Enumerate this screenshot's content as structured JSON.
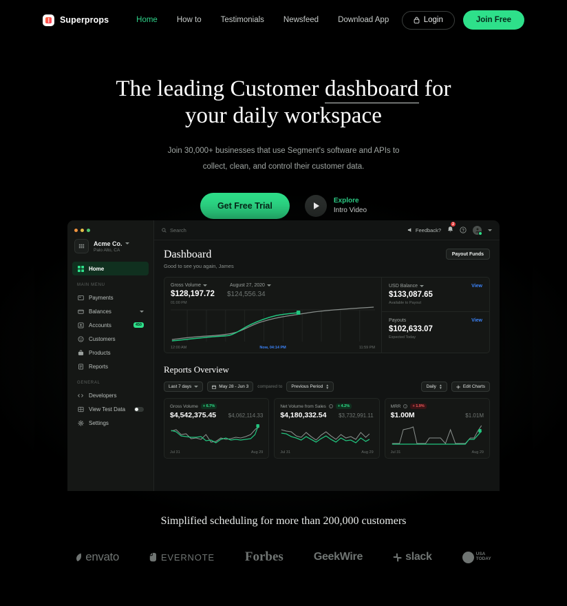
{
  "nav": {
    "brand": "Superprops",
    "links": [
      {
        "label": "Home",
        "active": true
      },
      {
        "label": "How to",
        "active": false
      },
      {
        "label": "Testimonials",
        "active": false
      },
      {
        "label": "Newsfeed",
        "active": false
      },
      {
        "label": "Download App",
        "active": false
      }
    ],
    "login_label": "Login",
    "join_label": "Join Free"
  },
  "hero": {
    "heading_part1": "The leading Customer ",
    "heading_underlined": "dashboard",
    "heading_part2": " for",
    "heading_line2": "your daily workspace",
    "sub_line1": "Join 30,000+ businesses that use Segment's software and APIs to",
    "sub_line2": "collect, clean, and control their customer data.",
    "cta_label": "Get Free Trial",
    "video_line1": "Explore",
    "video_line2": "Intro Video",
    "accent_color": "#2ee08a"
  },
  "dashboard": {
    "org_name": "Acme Co.",
    "org_location": "Palo Alto, CA",
    "search_placeholder": "Search",
    "feedback_label": "Feedback?",
    "notification_count": "2",
    "sidebar": [
      {
        "label": "Home",
        "icon": "grid-icon",
        "selected": true
      },
      {
        "group": "MAIN MENU"
      },
      {
        "label": "Payments",
        "icon": "card-icon"
      },
      {
        "label": "Balances",
        "icon": "wallet-icon",
        "caret": true
      },
      {
        "label": "Accounts",
        "icon": "person-icon",
        "badge": "450"
      },
      {
        "label": "Customers",
        "icon": "smiley-icon"
      },
      {
        "label": "Products",
        "icon": "bag-icon"
      },
      {
        "label": "Reports",
        "icon": "document-icon"
      },
      {
        "group": "GENERAL"
      },
      {
        "label": "Developers",
        "icon": "code-icon"
      },
      {
        "label": "View Test Data",
        "icon": "chart-icon",
        "toggle": true
      },
      {
        "label": "Settings",
        "icon": "gear-icon"
      }
    ],
    "page_title": "Dashboard",
    "page_subtitle": "Good to see you again, James",
    "payout_button": "Payout Funds",
    "gross_volume": {
      "label": "Gross Volume",
      "date_label": "August 27, 2020",
      "value": "$128,197.72",
      "compare_value": "$124,556.34",
      "time_label": "01:00 PM",
      "axis_left": "12:00 AM",
      "axis_now": "Now, 04:14 PM",
      "axis_right": "11:59 PM"
    },
    "usd_balance": {
      "label": "USD Balance",
      "view": "View",
      "value": "$133,087.65",
      "sub": "Available to Payout"
    },
    "payouts": {
      "label": "Payouts",
      "view": "View",
      "value": "$102,633.07",
      "sub": "Expected Today"
    },
    "reports_title": "Reports Overview",
    "toolbar": {
      "range": "Last 7 days",
      "dates": "May 28 - Jun 3",
      "compared_to": "compared to",
      "period": "Previous Period",
      "granularity": "Daily",
      "edit_charts": "Edit Charts"
    },
    "metric_cards": [
      {
        "label": "Gross Volume",
        "delta": "+ 6.7%",
        "delta_dir": "up",
        "value": "$4,542,375.45",
        "compare": "$4,062,114.33",
        "axis_left": "Jul 31",
        "axis_right": "Aug 29",
        "has_info": false
      },
      {
        "label": "Net Volume from Sales",
        "delta": "+ 4.2%",
        "delta_dir": "up",
        "value": "$4,180,332.54",
        "compare": "$3,732,991.11",
        "axis_left": "Jul 31",
        "axis_right": "Aug 29",
        "has_info": true
      },
      {
        "label": "MRR",
        "delta": "+ 1.9%",
        "delta_dir": "down",
        "value": "$1.00M",
        "compare": "$1.01M",
        "axis_left": "Jul 31",
        "axis_right": "Aug 29",
        "has_info": true
      }
    ]
  },
  "footer": {
    "headline": "Simplified scheduling for more than 200,000 customers",
    "logos": [
      "envato",
      "EVERNOTE",
      "Forbes",
      "GeekWire",
      "slack",
      "USA TODAY"
    ]
  }
}
